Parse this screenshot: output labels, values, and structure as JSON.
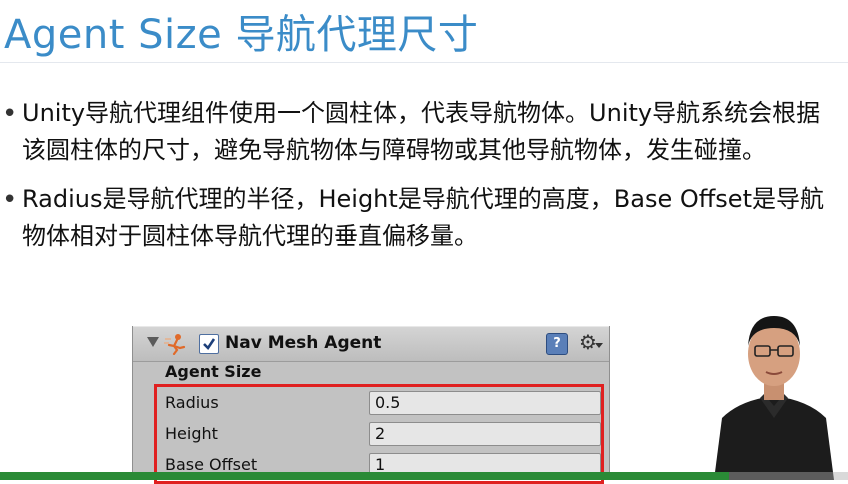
{
  "slide": {
    "title": "Agent Size 导航代理尺寸",
    "bullets": [
      {
        "marker": "•",
        "text": "Unity导航代理组件使用一个圆柱体，代表导航物体。Unity导航系统会根据该圆柱体的尺寸，避免导航物体与障碍物或其他导航物体，发生碰撞。"
      },
      {
        "marker": "•",
        "text": "Radius是导航代理的半径，Height是导航代理的高度，Base Offset是导航物体相对于圆柱体导航代理的垂直偏移量。"
      }
    ]
  },
  "inspector": {
    "component_title": "Nav Mesh Agent",
    "component_enabled": true,
    "section_label": "Agent Size",
    "help_icon_text": "?",
    "icons": {
      "foldout": "foldout-arrow-icon",
      "component": "nav-mesh-agent-icon",
      "help": "help-icon",
      "settings": "gear-icon"
    },
    "properties": [
      {
        "label": "Radius",
        "value": "0.5"
      },
      {
        "label": "Height",
        "value": "2"
      },
      {
        "label": "Base Offset",
        "value": "1"
      }
    ],
    "highlight_color": "#e02020"
  },
  "video": {
    "progress": 0.86,
    "progress_color": "#2a8a36"
  },
  "colors": {
    "title": "#3b8cc8",
    "body_text": "#111111",
    "inspector_bg": "#c2c2c2"
  }
}
